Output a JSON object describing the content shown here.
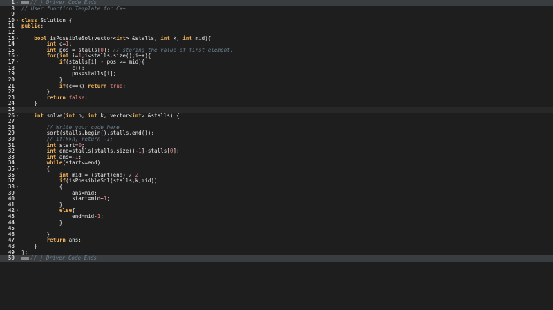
{
  "editor": {
    "lines": [
      {
        "n": "1",
        "fold": "▸",
        "state": "marked",
        "badge": true,
        "tokens": [
          {
            "t": "// } Driver Code Ends",
            "c": "cm"
          }
        ]
      },
      {
        "n": "8",
        "fold": "",
        "state": "",
        "tokens": [
          {
            "t": "// User function Template for C++",
            "c": "cm"
          }
        ]
      },
      {
        "n": "9",
        "fold": "",
        "state": "",
        "tokens": []
      },
      {
        "n": "10",
        "fold": "▾",
        "state": "",
        "tokens": [
          {
            "t": "class",
            "c": "kw"
          },
          {
            "t": " Solution {",
            "c": ""
          }
        ]
      },
      {
        "n": "11",
        "fold": "",
        "state": "",
        "tokens": [
          {
            "t": "public",
            "c": "kw"
          },
          {
            "t": ":",
            "c": ""
          }
        ]
      },
      {
        "n": "12",
        "fold": "",
        "state": "",
        "tokens": []
      },
      {
        "n": "13",
        "fold": "▾",
        "state": "",
        "tokens": [
          {
            "t": "    ",
            "c": ""
          },
          {
            "t": "bool",
            "c": "kw"
          },
          {
            "t": " isPossibleSol(vector<",
            "c": ""
          },
          {
            "t": "int",
            "c": "kw"
          },
          {
            "t": "> &stalls, ",
            "c": ""
          },
          {
            "t": "int",
            "c": "kw"
          },
          {
            "t": " k, ",
            "c": ""
          },
          {
            "t": "int",
            "c": "kw"
          },
          {
            "t": " mid){",
            "c": ""
          }
        ]
      },
      {
        "n": "14",
        "fold": "",
        "state": "",
        "tokens": [
          {
            "t": "        ",
            "c": ""
          },
          {
            "t": "int",
            "c": "kw"
          },
          {
            "t": " c=",
            "c": ""
          },
          {
            "t": "1",
            "c": "num"
          },
          {
            "t": ";",
            "c": ""
          }
        ]
      },
      {
        "n": "15",
        "fold": "",
        "state": "",
        "tokens": [
          {
            "t": "        ",
            "c": ""
          },
          {
            "t": "int",
            "c": "kw"
          },
          {
            "t": " pos = stalls[",
            "c": ""
          },
          {
            "t": "0",
            "c": "num"
          },
          {
            "t": "]; ",
            "c": ""
          },
          {
            "t": "// storing the value of first element.",
            "c": "cm"
          }
        ]
      },
      {
        "n": "16",
        "fold": "▾",
        "state": "",
        "tokens": [
          {
            "t": "        ",
            "c": ""
          },
          {
            "t": "for",
            "c": "kw"
          },
          {
            "t": "(",
            "c": ""
          },
          {
            "t": "int",
            "c": "kw"
          },
          {
            "t": " i=",
            "c": ""
          },
          {
            "t": "1",
            "c": "num"
          },
          {
            "t": ";i<stalls.size();i++){",
            "c": ""
          }
        ]
      },
      {
        "n": "17",
        "fold": "▾",
        "state": "",
        "tokens": [
          {
            "t": "            ",
            "c": ""
          },
          {
            "t": "if",
            "c": "kw"
          },
          {
            "t": "(stalls[i] - pos >= mid){",
            "c": ""
          }
        ]
      },
      {
        "n": "18",
        "fold": "",
        "state": "",
        "tokens": [
          {
            "t": "                c++;",
            "c": ""
          }
        ]
      },
      {
        "n": "19",
        "fold": "",
        "state": "",
        "tokens": [
          {
            "t": "                pos=stalls[i];",
            "c": ""
          }
        ]
      },
      {
        "n": "20",
        "fold": "",
        "state": "",
        "tokens": [
          {
            "t": "            }",
            "c": ""
          }
        ]
      },
      {
        "n": "21",
        "fold": "",
        "state": "",
        "tokens": [
          {
            "t": "            ",
            "c": ""
          },
          {
            "t": "if",
            "c": "kw"
          },
          {
            "t": "(c==k) ",
            "c": ""
          },
          {
            "t": "return",
            "c": "kw"
          },
          {
            "t": " ",
            "c": ""
          },
          {
            "t": "true",
            "c": "num"
          },
          {
            "t": ";",
            "c": ""
          }
        ]
      },
      {
        "n": "22",
        "fold": "",
        "state": "",
        "tokens": [
          {
            "t": "        }",
            "c": ""
          }
        ]
      },
      {
        "n": "23",
        "fold": "",
        "state": "",
        "tokens": [
          {
            "t": "        ",
            "c": ""
          },
          {
            "t": "return",
            "c": "kw"
          },
          {
            "t": " ",
            "c": ""
          },
          {
            "t": "false",
            "c": "num"
          },
          {
            "t": ";",
            "c": ""
          }
        ]
      },
      {
        "n": "24",
        "fold": "",
        "state": "",
        "tokens": [
          {
            "t": "    }",
            "c": ""
          }
        ]
      },
      {
        "n": "25",
        "fold": "",
        "state": "active",
        "tokens": []
      },
      {
        "n": "26",
        "fold": "▾",
        "state": "",
        "tokens": [
          {
            "t": "    ",
            "c": ""
          },
          {
            "t": "int",
            "c": "kw"
          },
          {
            "t": " solve(",
            "c": ""
          },
          {
            "t": "int",
            "c": "kw"
          },
          {
            "t": " n, ",
            "c": ""
          },
          {
            "t": "int",
            "c": "kw"
          },
          {
            "t": " k, vector<",
            "c": ""
          },
          {
            "t": "int",
            "c": "kw"
          },
          {
            "t": "> &stalls) {",
            "c": ""
          }
        ]
      },
      {
        "n": "27",
        "fold": "",
        "state": "",
        "tokens": []
      },
      {
        "n": "28",
        "fold": "",
        "state": "",
        "tokens": [
          {
            "t": "        ",
            "c": ""
          },
          {
            "t": "// Write your code here",
            "c": "cm"
          }
        ]
      },
      {
        "n": "29",
        "fold": "",
        "state": "",
        "tokens": [
          {
            "t": "        sort(stalls.begin(),stalls.end());",
            "c": ""
          }
        ]
      },
      {
        "n": "30",
        "fold": "",
        "state": "",
        "tokens": [
          {
            "t": "        ",
            "c": ""
          },
          {
            "t": "// if(k>n) return -1;",
            "c": "cm"
          }
        ]
      },
      {
        "n": "31",
        "fold": "",
        "state": "",
        "tokens": [
          {
            "t": "        ",
            "c": ""
          },
          {
            "t": "int",
            "c": "kw"
          },
          {
            "t": " start=",
            "c": ""
          },
          {
            "t": "0",
            "c": "num"
          },
          {
            "t": ";",
            "c": ""
          }
        ]
      },
      {
        "n": "32",
        "fold": "",
        "state": "",
        "tokens": [
          {
            "t": "        ",
            "c": ""
          },
          {
            "t": "int",
            "c": "kw"
          },
          {
            "t": " end=stalls[stalls.size()-",
            "c": ""
          },
          {
            "t": "1",
            "c": "num"
          },
          {
            "t": "]-stalls[",
            "c": ""
          },
          {
            "t": "0",
            "c": "num"
          },
          {
            "t": "];",
            "c": ""
          }
        ]
      },
      {
        "n": "33",
        "fold": "",
        "state": "",
        "tokens": [
          {
            "t": "        ",
            "c": ""
          },
          {
            "t": "int",
            "c": "kw"
          },
          {
            "t": " ans=-",
            "c": ""
          },
          {
            "t": "1",
            "c": "num"
          },
          {
            "t": ";",
            "c": ""
          }
        ]
      },
      {
        "n": "34",
        "fold": "",
        "state": "",
        "tokens": [
          {
            "t": "        ",
            "c": ""
          },
          {
            "t": "while",
            "c": "kw"
          },
          {
            "t": "(start<=end)",
            "c": ""
          }
        ]
      },
      {
        "n": "35",
        "fold": "▾",
        "state": "",
        "tokens": [
          {
            "t": "        {",
            "c": ""
          }
        ]
      },
      {
        "n": "36",
        "fold": "",
        "state": "",
        "tokens": [
          {
            "t": "            ",
            "c": ""
          },
          {
            "t": "int",
            "c": "kw"
          },
          {
            "t": " mid = (start+end) / ",
            "c": ""
          },
          {
            "t": "2",
            "c": "num"
          },
          {
            "t": ";",
            "c": ""
          }
        ]
      },
      {
        "n": "37",
        "fold": "",
        "state": "",
        "tokens": [
          {
            "t": "            ",
            "c": ""
          },
          {
            "t": "if",
            "c": "kw"
          },
          {
            "t": "(isPossibleSol(stalls,k,mid))",
            "c": ""
          }
        ]
      },
      {
        "n": "38",
        "fold": "▾",
        "state": "",
        "tokens": [
          {
            "t": "            {",
            "c": ""
          }
        ]
      },
      {
        "n": "39",
        "fold": "",
        "state": "",
        "tokens": [
          {
            "t": "                ans=mid;",
            "c": ""
          }
        ]
      },
      {
        "n": "40",
        "fold": "",
        "state": "",
        "tokens": [
          {
            "t": "                start=mid+",
            "c": ""
          },
          {
            "t": "1",
            "c": "num"
          },
          {
            "t": ";",
            "c": ""
          }
        ]
      },
      {
        "n": "41",
        "fold": "",
        "state": "",
        "tokens": [
          {
            "t": "            }",
            "c": ""
          }
        ]
      },
      {
        "n": "42",
        "fold": "▾",
        "state": "",
        "tokens": [
          {
            "t": "            ",
            "c": ""
          },
          {
            "t": "else",
            "c": "kw"
          },
          {
            "t": "{",
            "c": ""
          }
        ]
      },
      {
        "n": "43",
        "fold": "",
        "state": "",
        "tokens": [
          {
            "t": "                end=mid-",
            "c": ""
          },
          {
            "t": "1",
            "c": "num"
          },
          {
            "t": ";",
            "c": ""
          }
        ]
      },
      {
        "n": "44",
        "fold": "",
        "state": "",
        "tokens": [
          {
            "t": "            }",
            "c": ""
          }
        ]
      },
      {
        "n": "45",
        "fold": "",
        "state": "",
        "tokens": []
      },
      {
        "n": "46",
        "fold": "",
        "state": "",
        "tokens": [
          {
            "t": "        }",
            "c": ""
          }
        ]
      },
      {
        "n": "47",
        "fold": "",
        "state": "",
        "tokens": [
          {
            "t": "        ",
            "c": ""
          },
          {
            "t": "return",
            "c": "kw"
          },
          {
            "t": " ans;",
            "c": ""
          }
        ]
      },
      {
        "n": "48",
        "fold": "",
        "state": "",
        "tokens": [
          {
            "t": "    }",
            "c": ""
          }
        ]
      },
      {
        "n": "49",
        "fold": "",
        "state": "",
        "tokens": [
          {
            "t": "};",
            "c": ""
          }
        ]
      },
      {
        "n": "50",
        "fold": "▸",
        "state": "marked",
        "badge": true,
        "tokens": [
          {
            "t": "// } Driver Code Ends",
            "c": "cm"
          }
        ]
      }
    ]
  },
  "colors": {
    "background": "#1e1e1e",
    "keyword": "#f0b25a",
    "comment": "#6a7f8c",
    "number": "#e97f7f",
    "text": "#e8e8e8",
    "line_number": "#d4d4d4"
  },
  "icons": {
    "fold_expanded": "fold-open-icon",
    "fold_collapsed": "fold-closed-icon"
  }
}
